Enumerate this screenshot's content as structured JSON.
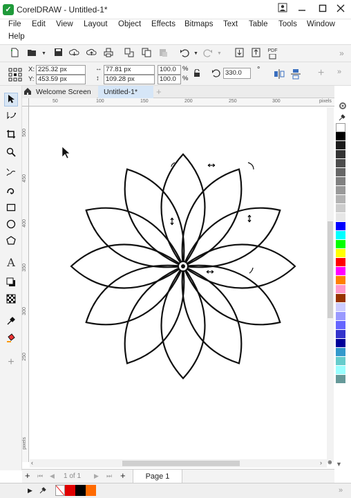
{
  "window": {
    "title": "CorelDRAW - Untitled-1*",
    "logo": "CorelDRAW logo",
    "buttons": [
      "user-icon",
      "minimize-icon",
      "maximize-icon",
      "close-icon"
    ]
  },
  "menu": [
    "File",
    "Edit",
    "View",
    "Layout",
    "Object",
    "Effects",
    "Bitmaps",
    "Text",
    "Table",
    "Tools",
    "Window",
    "Help"
  ],
  "standard_toolbar": {
    "icons": [
      "new-document-icon",
      "open-icon",
      "save-icon",
      "import-cloud-icon",
      "export-cloud-icon",
      "print-icon",
      "cut-icon",
      "copy-icon",
      "paste-icon",
      "undo-icon",
      "redo-icon",
      "import-icon",
      "export-icon",
      "publish-pdf-icon"
    ],
    "pdf_label": "PDF"
  },
  "property_bar": {
    "x_label": "X:",
    "x_value": "225.32 px",
    "y_label": "Y:",
    "y_value": "453.59 px",
    "w_value": "77.81 px",
    "h_value": "109.28 px",
    "scale_w": "100.0",
    "scale_h": "100.0",
    "percent": "%",
    "rotation": "330.0",
    "rotation_unit": "°"
  },
  "doc_tabs": [
    {
      "label": "Welcome Screen",
      "icon": "home-icon"
    },
    {
      "label": "Untitled-1*"
    }
  ],
  "rulers": {
    "h_ticks": [
      "50",
      "100",
      "150",
      "200",
      "250",
      "300"
    ],
    "h_unit": "pixels",
    "v_ticks": [
      "500",
      "450",
      "400",
      "350",
      "300",
      "250"
    ],
    "v_unit": "pixels"
  },
  "page_nav": {
    "page_count": "1 of 1",
    "page_tab": "Page 1"
  },
  "palette_colors": [
    "#ffffff",
    "#000000",
    "#1a1a1a",
    "#333333",
    "#4d4d4d",
    "#666666",
    "#808080",
    "#999999",
    "#b3b3b3",
    "#cccccc",
    "#e6e6e6",
    "#0000ff",
    "#00ffff",
    "#00ff00",
    "#ffff00",
    "#ff0000",
    "#ff00ff",
    "#ff8000",
    "#ff99cc",
    "#993300",
    "#ccccff",
    "#9999ff",
    "#6666ff",
    "#3333cc",
    "#000099",
    "#3399cc",
    "#66cccc",
    "#99ffff",
    "#669999"
  ],
  "status_colors": {
    "fill": "#ffffff",
    "c1": "#e00000",
    "c2": "#000000",
    "c3": "#ff6a00"
  }
}
